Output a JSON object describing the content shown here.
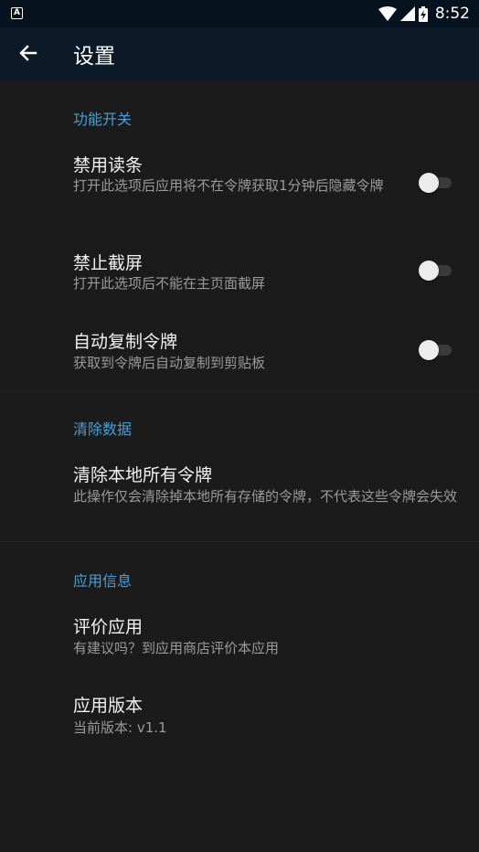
{
  "status_bar": {
    "time": "8:52",
    "notification_glyph": "A",
    "icons": [
      "wifi-icon",
      "cell-signal-icon",
      "battery-charging-icon"
    ]
  },
  "app_bar": {
    "title": "设置",
    "back_icon": "arrow-back-icon"
  },
  "sections": [
    {
      "header": "功能开关",
      "items": [
        {
          "title": "禁用读条",
          "summary": "打开此选项后应用将不在令牌获取1分钟后隐藏令牌",
          "toggle": false
        },
        {
          "title": "禁止截屏",
          "summary": "打开此选项后不能在主页面截屏",
          "toggle": false
        },
        {
          "title": "自动复制令牌",
          "summary": "获取到令牌后自动复制到剪贴板",
          "toggle": false
        }
      ]
    },
    {
      "header": "清除数据",
      "items": [
        {
          "title": "清除本地所有令牌",
          "summary": "此操作仅会清除掉本地所有存储的令牌，不代表这些令牌会失效"
        }
      ]
    },
    {
      "header": "应用信息",
      "items": [
        {
          "title": "评价应用",
          "summary": "有建议吗？到应用商店评价本应用"
        },
        {
          "title": "应用版本",
          "summary": "当前版本: v1.1"
        }
      ]
    }
  ],
  "colors": {
    "background": "#1b1b1b",
    "app_bar": "#0c1a28",
    "status_bar": "#06121e",
    "accent": "#4a9fd6",
    "summary_text": "#9a9a9a"
  }
}
